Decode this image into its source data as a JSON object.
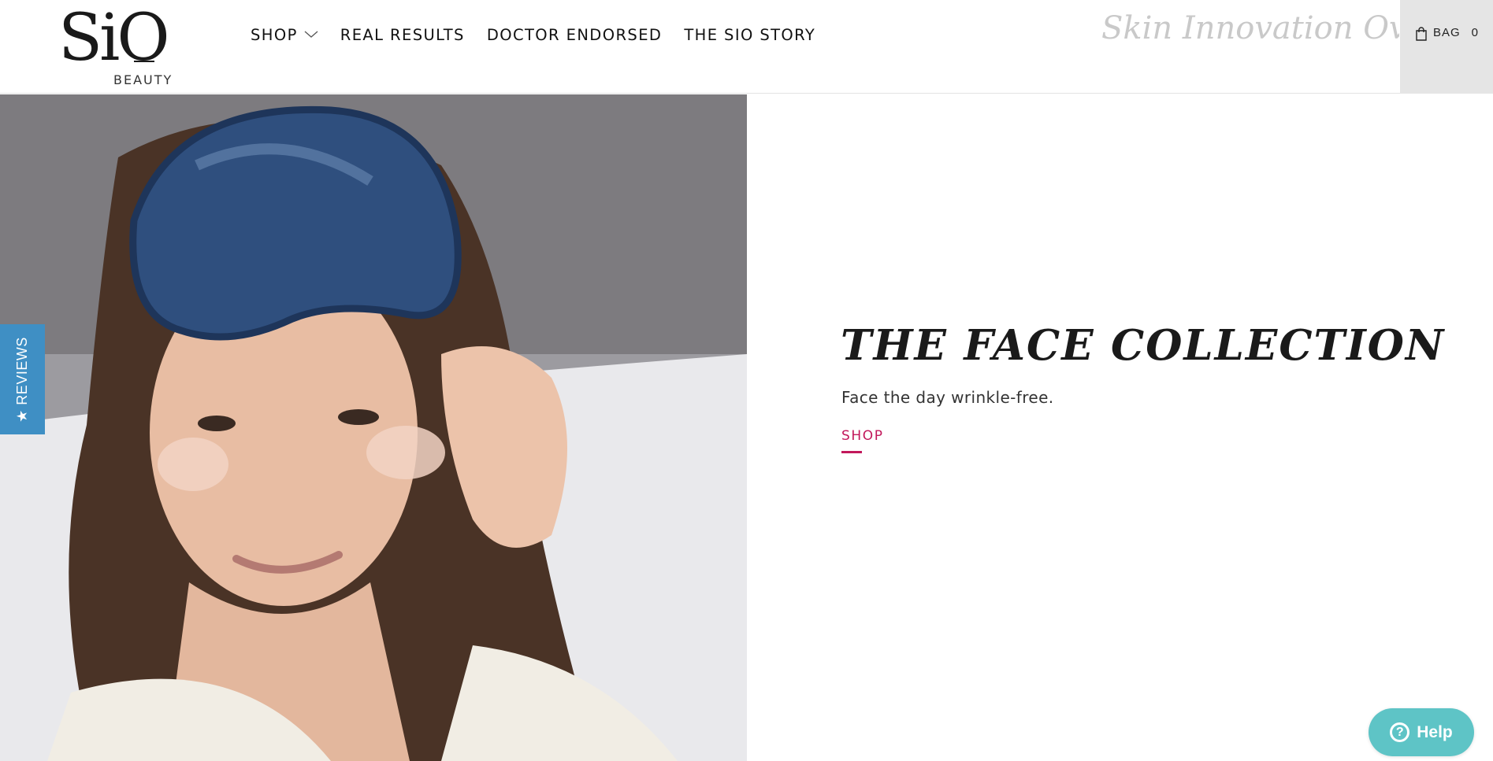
{
  "brand": {
    "logo_main": "SiO",
    "logo_sub": "BEAUTY"
  },
  "nav": {
    "items": [
      {
        "label": "SHOP",
        "has_dropdown": true
      },
      {
        "label": "REAL RESULTS"
      },
      {
        "label": "DOCTOR ENDORSED"
      },
      {
        "label": "THE SIO STORY"
      }
    ]
  },
  "header": {
    "tagline": "Skin Innovation Overnight"
  },
  "bag": {
    "label": "BAG",
    "count": "0"
  },
  "hero": {
    "title": "THE FACE COLLECTION",
    "subtitle": "Face the day wrinkle-free.",
    "cta_label": "SHOP",
    "image_icon": "woman-with-sleep-mask-photo"
  },
  "reviews_tab": {
    "label": "★ REVIEWS"
  },
  "help": {
    "icon": "?",
    "label": "Help"
  },
  "colors": {
    "accent": "#c2185b",
    "reviews_tab": "#3f8fc4",
    "help_button": "#5ec4c6",
    "bag_bg": "#e5e5e5",
    "tagline": "#c9c9c9"
  }
}
